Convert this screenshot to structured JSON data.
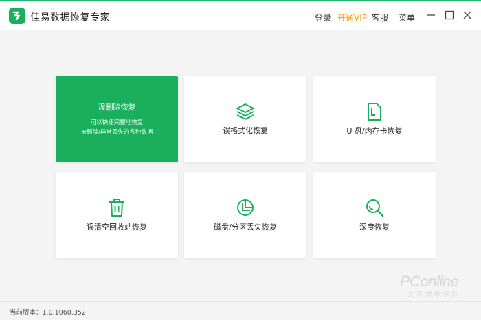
{
  "app": {
    "title": "佳易数据恢复专家",
    "logo_icon": "app-logo-icon",
    "brand_color": "#1aaf5d"
  },
  "header": {
    "login_label": "登录",
    "vip_label": "开通VIP",
    "service_label": "客服",
    "menu_label": "菜单",
    "vip_color": "#f29a17"
  },
  "window_controls": {
    "minimize_icon": "minimize-icon",
    "maximize_icon": "maximize-icon",
    "close_icon": "close-icon"
  },
  "cards": [
    {
      "label": "误删除恢复",
      "desc_line1": "可以快速完整地恢复",
      "desc_line2": "被删除/异常丢失的各种数据",
      "active": true
    },
    {
      "label": "误格式化恢复",
      "icon": "layers-icon"
    },
    {
      "label": "U 盘/内存卡恢复",
      "icon": "sd-card-icon"
    },
    {
      "label": "误清空回收站恢复",
      "icon": "trash-icon"
    },
    {
      "label": "磁盘/分区丢失恢复",
      "icon": "pie-chart-icon"
    },
    {
      "label": "深度恢复",
      "icon": "magnifier-icon"
    }
  ],
  "status": {
    "version_text": "当前版本：1.0.1060.352"
  },
  "watermark": {
    "text": "PConline",
    "sub": "太平洋电脑网"
  }
}
